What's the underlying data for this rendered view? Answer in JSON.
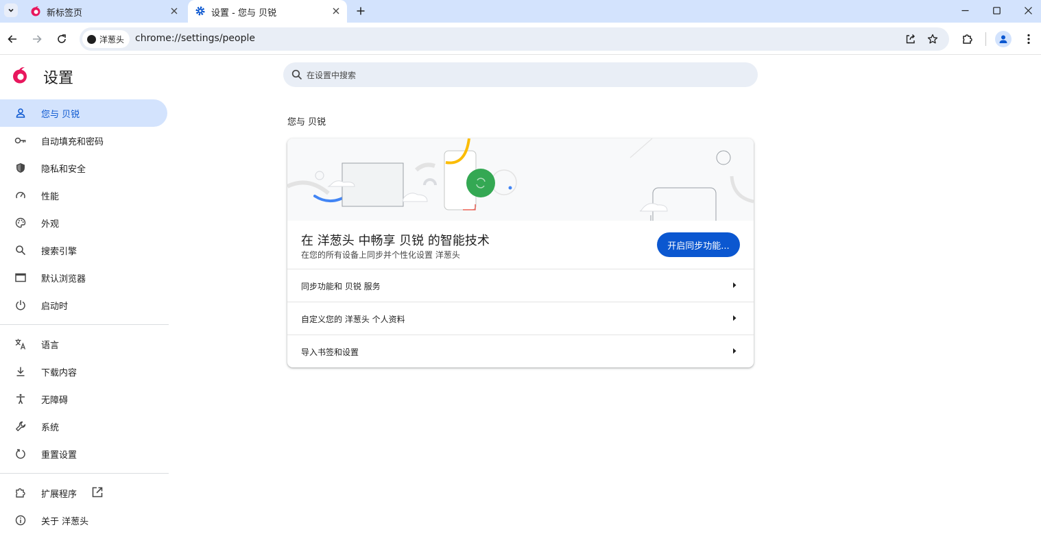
{
  "browser": {
    "tabs": [
      {
        "title": "新标签页",
        "active": false
      },
      {
        "title": "设置 - 您与 贝锐",
        "active": true
      }
    ],
    "omnibox": {
      "chip_label": "洋葱头",
      "url": "chrome://settings/people"
    }
  },
  "settings": {
    "title": "设置",
    "search_placeholder": "在设置中搜索",
    "nav": [
      {
        "label": "您与 贝锐",
        "icon": "person-icon",
        "active": true
      },
      {
        "label": "自动填充和密码",
        "icon": "key-icon"
      },
      {
        "label": "隐私和安全",
        "icon": "shield-icon"
      },
      {
        "label": "性能",
        "icon": "speedometer-icon"
      },
      {
        "label": "外观",
        "icon": "palette-icon"
      },
      {
        "label": "搜索引擎",
        "icon": "search-icon"
      },
      {
        "label": "默认浏览器",
        "icon": "browser-window-icon"
      },
      {
        "label": "启动时",
        "icon": "power-icon"
      },
      {
        "label": "语言",
        "icon": "translate-icon"
      },
      {
        "label": "下载内容",
        "icon": "download-icon"
      },
      {
        "label": "无障碍",
        "icon": "accessibility-icon"
      },
      {
        "label": "系统",
        "icon": "wrench-icon"
      },
      {
        "label": "重置设置",
        "icon": "reset-icon"
      },
      {
        "label": "扩展程序",
        "icon": "puzzle-icon"
      },
      {
        "label": "关于 洋葱头",
        "icon": "info-icon"
      }
    ],
    "section_title": "您与 贝锐",
    "card": {
      "title": "在 洋葱头 中畅享 贝锐 的智能技术",
      "subtitle": "在您的所有设备上同步并个性化设置 洋葱头",
      "button": "开启同步功能...",
      "rows": [
        {
          "label": "同步功能和 贝锐 服务"
        },
        {
          "label": "自定义您的 洋葱头 个人资料"
        },
        {
          "label": "导入书签和设置"
        }
      ]
    }
  },
  "colors": {
    "accent": "#0b57d0",
    "tabstrip": "#d3e3fd",
    "nav_active": "#d3e3fd",
    "brand": "#e8175d"
  }
}
